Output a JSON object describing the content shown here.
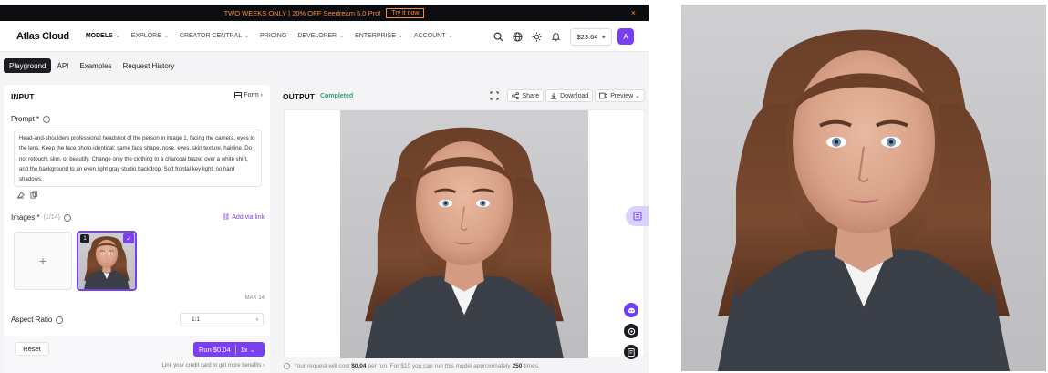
{
  "promo": {
    "text": "TWO WEEKS ONLY | 20% OFF Seedream 5.0 Pro!",
    "cta": "Try it now",
    "close": "×"
  },
  "nav": {
    "logo": "Atlas Cloud",
    "items": [
      "MODELS",
      "EXPLORE",
      "CREATOR CENTRAL",
      "PRICING",
      "DEVELOPER",
      "ENTERPRISE",
      "ACCOUNT"
    ],
    "balance": "$23.64",
    "balance_plus": "+",
    "avatar": "A"
  },
  "tabs": [
    "Playground",
    "API",
    "Examples",
    "Request History"
  ],
  "input": {
    "title": "INPUT",
    "form_link": "Form",
    "prompt_label": "Prompt",
    "prompt_required": "*",
    "prompt_text": "Head-and-shoulders professional headshot of the person in image 1, facing the camera, eyes to the lens. Keep the face photo-identical: same face shape, nose, eyes, skin texture, hairline. Do not retouch, slim, or beautify. Change only the clothing to a charcoal blazer over a white shirt, and the background to an even light gray studio backdrop. Soft frontal key light, no hard shadows.",
    "images_label": "Images",
    "images_required": "*",
    "images_count": "(1/14)",
    "add_url": "Add via link",
    "upload_plus": "+",
    "thumb_index": "1",
    "max_note": "MAX 14",
    "aspect_label": "Aspect Ratio",
    "aspect_value": "1:1",
    "reset": "Reset",
    "run": "Run $0.04",
    "run_count": "1x",
    "card_note": "Link your credit card to get more benefits"
  },
  "output": {
    "title": "OUTPUT",
    "status": "Completed",
    "share": "Share",
    "download": "Download",
    "preview": "Preview",
    "cost_prefix": "Your request will cost",
    "cost_value": "$0.04",
    "cost_mid": "per run. For $10 you can run this model approximately",
    "cost_runs": "250",
    "cost_suffix": "times."
  },
  "colors": {
    "accent": "#7b3ff2",
    "success": "#2aa56f",
    "promo": "#ff8a3d"
  }
}
